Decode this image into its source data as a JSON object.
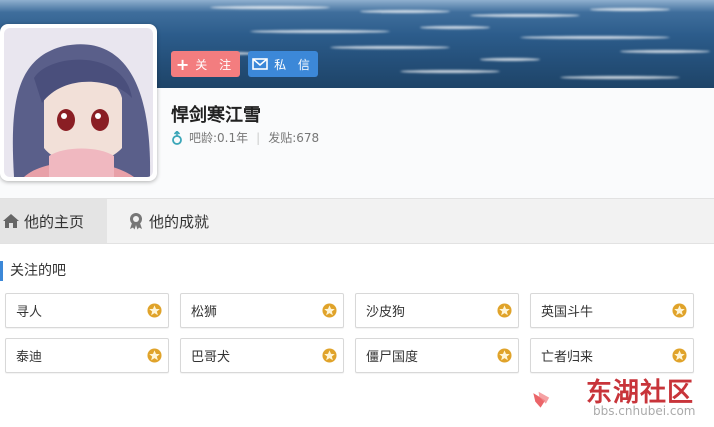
{
  "header": {
    "follow_label": "关 注",
    "message_label": "私 信"
  },
  "profile": {
    "username": "悍剑寒江雪",
    "age": "吧龄:0.1年",
    "posts": "发贴:678"
  },
  "tabs": [
    {
      "label": "他的主页",
      "icon": "home-icon"
    },
    {
      "label": "他的成就",
      "icon": "medal-icon"
    }
  ],
  "section": {
    "title": "关注的吧"
  },
  "forums": [
    {
      "name": "寻人"
    },
    {
      "name": "松狮"
    },
    {
      "name": "沙皮狗"
    },
    {
      "name": "英国斗牛"
    },
    {
      "name": "泰迪"
    },
    {
      "name": "巴哥犬"
    },
    {
      "name": "僵尸国度"
    },
    {
      "name": "亡者归来"
    }
  ],
  "watermark": {
    "brand": "东湖社区",
    "url": "bbs.cnhubei.com"
  },
  "colors": {
    "accent": "#3c88d8",
    "follow": "#f37d7f",
    "star": "#e0a32a"
  }
}
